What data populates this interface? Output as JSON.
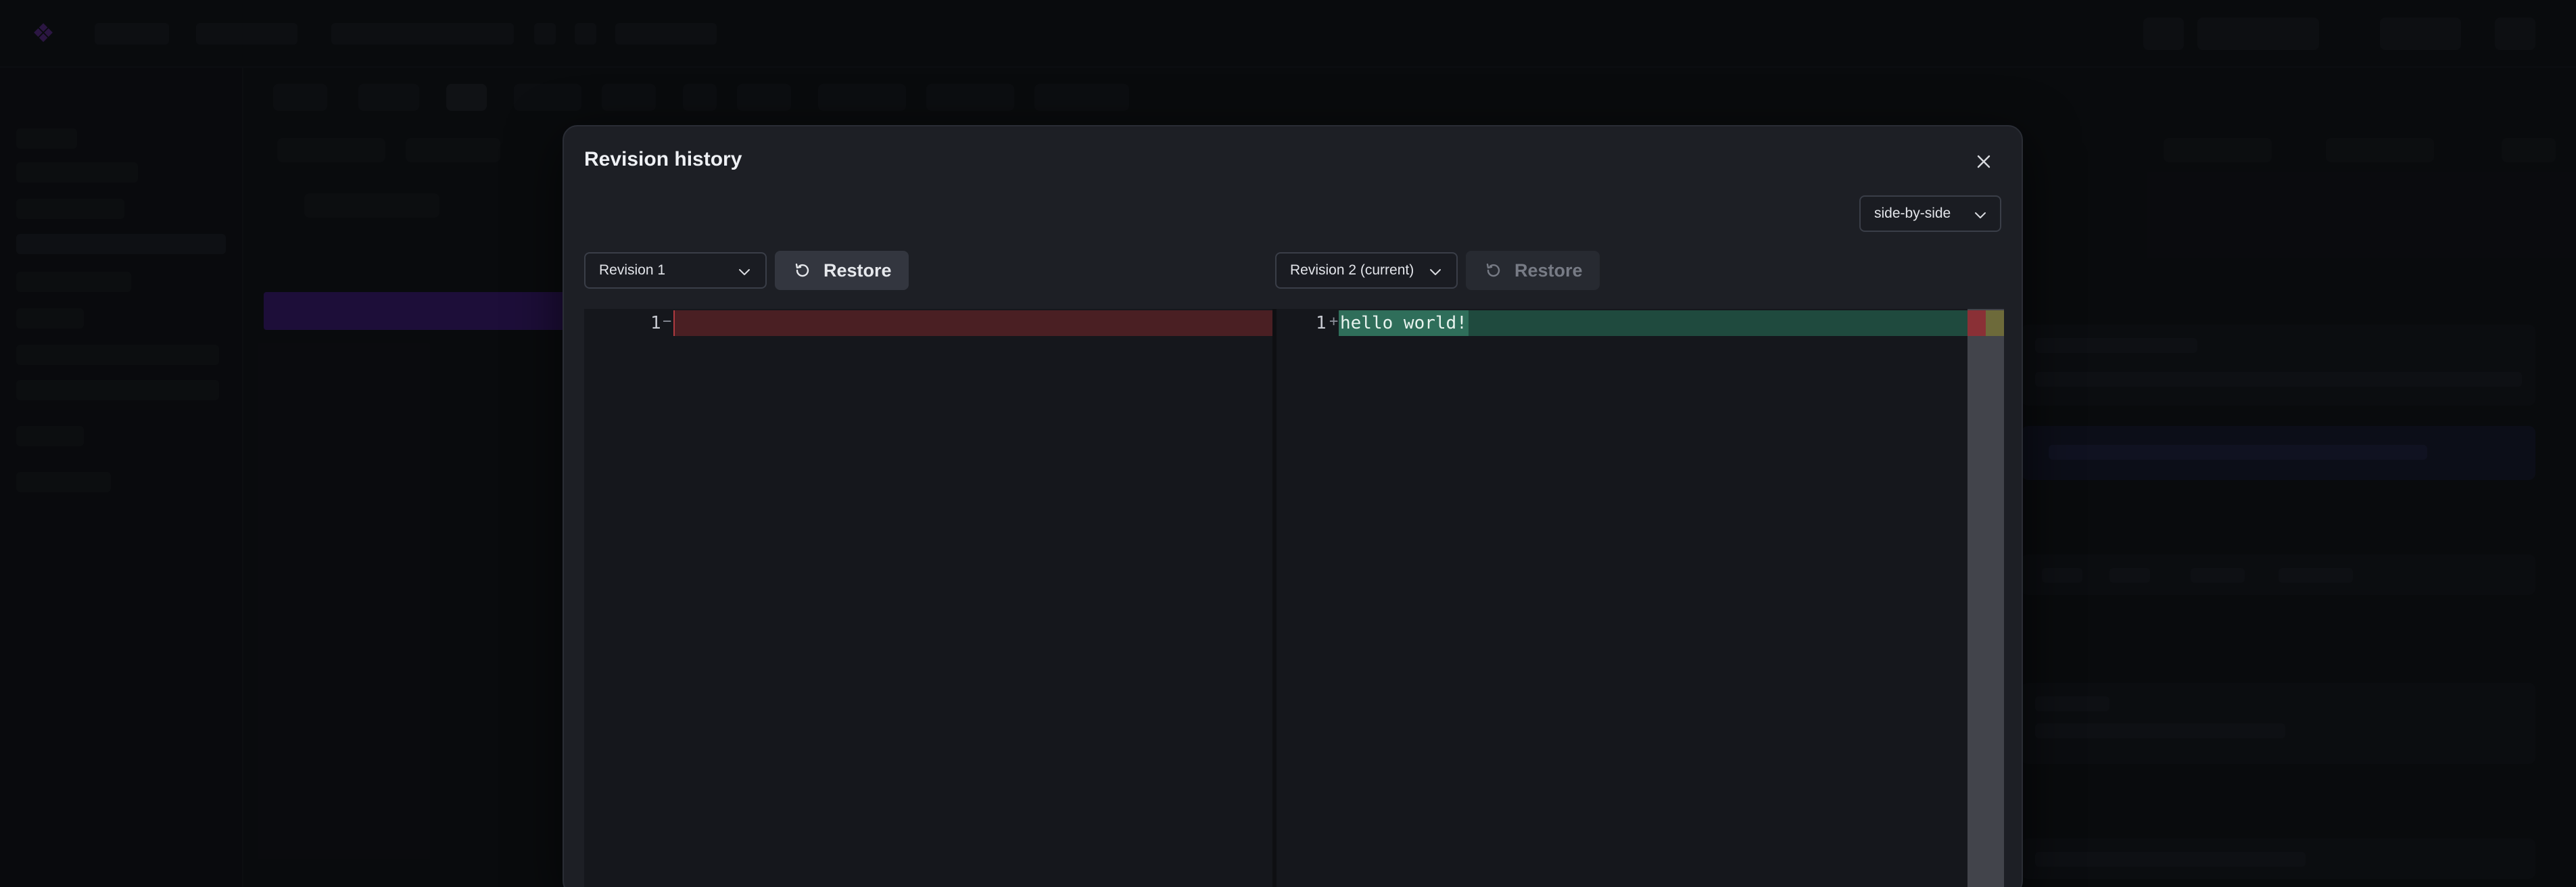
{
  "modal": {
    "title": "Revision history",
    "view_mode": "side-by-side",
    "left": {
      "revision": "Revision 1",
      "restore_label": "Restore",
      "line_number": "1",
      "marker": "−",
      "content": ""
    },
    "right": {
      "revision": "Revision 2 (current)",
      "restore_label": "Restore",
      "line_number": "1",
      "marker": "+",
      "content": "hello world!"
    }
  },
  "colors": {
    "removed_bg": "#4a1f23",
    "added_bg": "#1f4a3e",
    "added_highlight": "#2f6e5a",
    "modal_bg": "#1d1f25"
  },
  "icons": {
    "close": "close-icon",
    "chevron": "chevron-down-icon",
    "restore": "restore-icon"
  }
}
